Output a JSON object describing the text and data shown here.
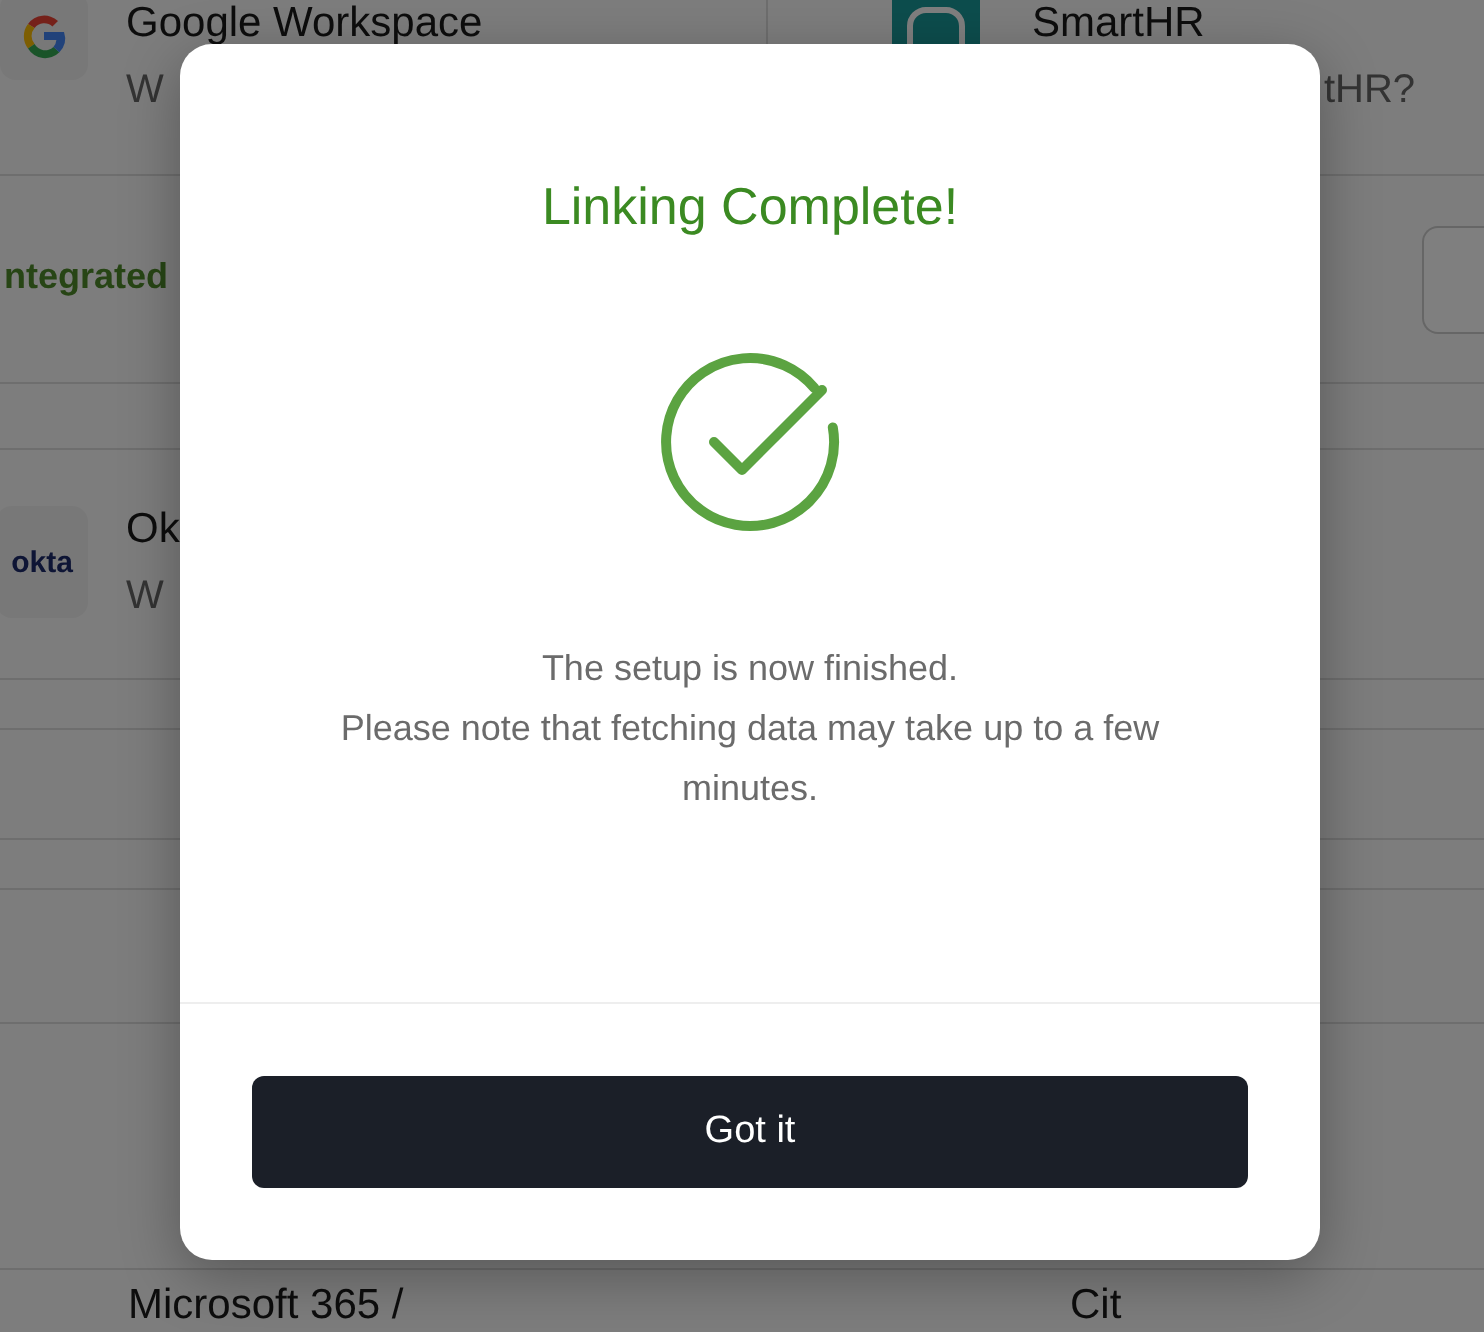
{
  "background": {
    "top_cards": [
      {
        "kind": "google",
        "title": "Google Workspace",
        "subtitle": "W"
      },
      {
        "kind": "smarthr",
        "title": "SmartHR",
        "subtitle": "tHR?"
      }
    ],
    "status": "ntegrated",
    "middle_cards": [
      {
        "kind": "okta",
        "logo_text": "okta",
        "title": "Ok",
        "subtitle": "W"
      }
    ],
    "bottom_cards": [
      {
        "title": "Microsoft 365 /"
      },
      {
        "title": "Cit"
      }
    ]
  },
  "dialog": {
    "title": "Linking Complete!",
    "lines": [
      "The setup is now finished.",
      "Please note that fetching data may take up to a few minutes."
    ],
    "button": "Got it"
  }
}
